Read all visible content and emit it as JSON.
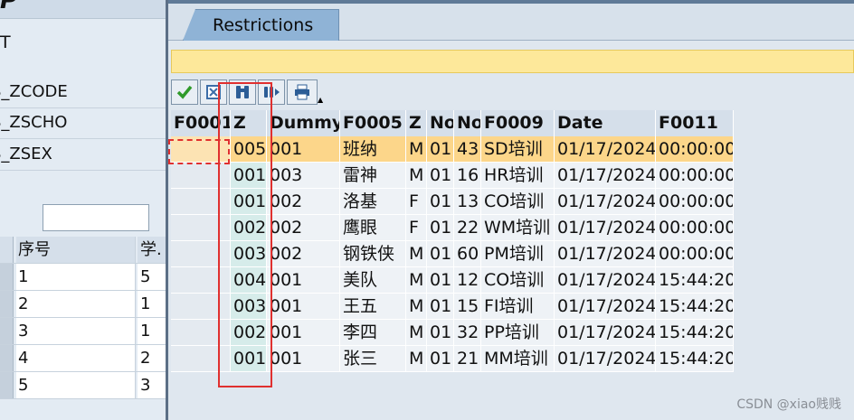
{
  "background_window": {
    "logo": "P",
    "title": "T",
    "fields": [
      "S_ZCODE",
      "S_ZSCHO",
      "S_ZSEX"
    ],
    "table_headers": [
      "序号",
      "学."
    ],
    "table_rows": [
      [
        "1",
        "5"
      ],
      [
        "2",
        "1"
      ],
      [
        "3",
        "1"
      ],
      [
        "4",
        "2"
      ],
      [
        "5",
        "3"
      ]
    ]
  },
  "popup": {
    "tab_label": "Restrictions",
    "toolbar": [
      {
        "name": "continue",
        "icon": "checkmark-icon"
      },
      {
        "name": "select-all",
        "icon": "select-all-icon"
      },
      {
        "name": "find",
        "icon": "binoculars-icon"
      },
      {
        "name": "find-next",
        "icon": "find-next-icon"
      },
      {
        "name": "print",
        "icon": "printer-icon"
      }
    ],
    "columns": [
      "F0001",
      "Z",
      "Dummy",
      "F0005",
      "Z",
      "No",
      "No",
      "F0009",
      "Date",
      "F0011"
    ],
    "rows": [
      [
        "",
        "005",
        "001",
        "班纳",
        "M",
        "01",
        "43",
        "SD培训",
        "01/17/2024",
        "00:00:00"
      ],
      [
        "",
        "001",
        "003",
        "雷神",
        "M",
        "01",
        "16",
        "HR培训",
        "01/17/2024",
        "00:00:00"
      ],
      [
        "",
        "001",
        "002",
        "洛基",
        "F",
        "01",
        "13",
        "CO培训",
        "01/17/2024",
        "00:00:00"
      ],
      [
        "",
        "002",
        "002",
        "鹰眼",
        "F",
        "01",
        "22",
        "WM培训",
        "01/17/2024",
        "00:00:00"
      ],
      [
        "",
        "003",
        "002",
        "钢铁侠",
        "M",
        "01",
        "60",
        "PM培训",
        "01/17/2024",
        "00:00:00"
      ],
      [
        "",
        "004",
        "001",
        "美队",
        "M",
        "01",
        "12",
        "CO培训",
        "01/17/2024",
        "15:44:20"
      ],
      [
        "",
        "003",
        "001",
        "王五",
        "M",
        "01",
        "15",
        "FI培训",
        "01/17/2024",
        "15:44:20"
      ],
      [
        "",
        "002",
        "001",
        "李四",
        "M",
        "01",
        "32",
        "PP培训",
        "01/17/2024",
        "15:44:20"
      ],
      [
        "",
        "001",
        "001",
        "张三",
        "M",
        "01",
        "21",
        "MM培训",
        "01/17/2024",
        "15:44:20"
      ]
    ],
    "selected_row": 0
  },
  "colors": {
    "highlight_row": "#fcd68a",
    "annotation": "#e0302f",
    "tab": "#8fb3d6"
  },
  "watermark": "CSDN @xiao贱贱"
}
